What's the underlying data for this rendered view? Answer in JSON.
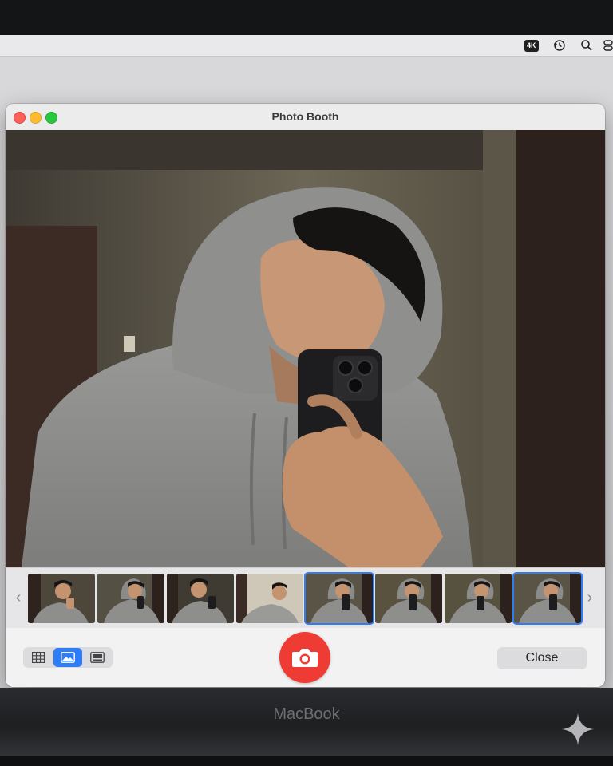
{
  "menubar": {
    "icons": [
      "4k-badge",
      "history-icon",
      "search-icon",
      "control-center-icon"
    ],
    "badge_text": "4K"
  },
  "window": {
    "title": "Photo Booth"
  },
  "filmstrip": {
    "left_arrow": "‹",
    "right_arrow": "›",
    "thumbnails": [
      {
        "selected": false
      },
      {
        "selected": false
      },
      {
        "selected": false
      },
      {
        "selected": false
      },
      {
        "selected": true
      },
      {
        "selected": false
      },
      {
        "selected": false
      },
      {
        "selected": true
      }
    ]
  },
  "toolbar": {
    "view_modes": [
      "grid-view",
      "single-photo-view",
      "effects-view"
    ],
    "active_view": "single-photo-view",
    "shutter": "camera-icon",
    "close_label": "Close"
  },
  "device": {
    "brand": "MacBook"
  },
  "colors": {
    "accent": "#2f7df6",
    "shutter": "#ee3b34"
  }
}
